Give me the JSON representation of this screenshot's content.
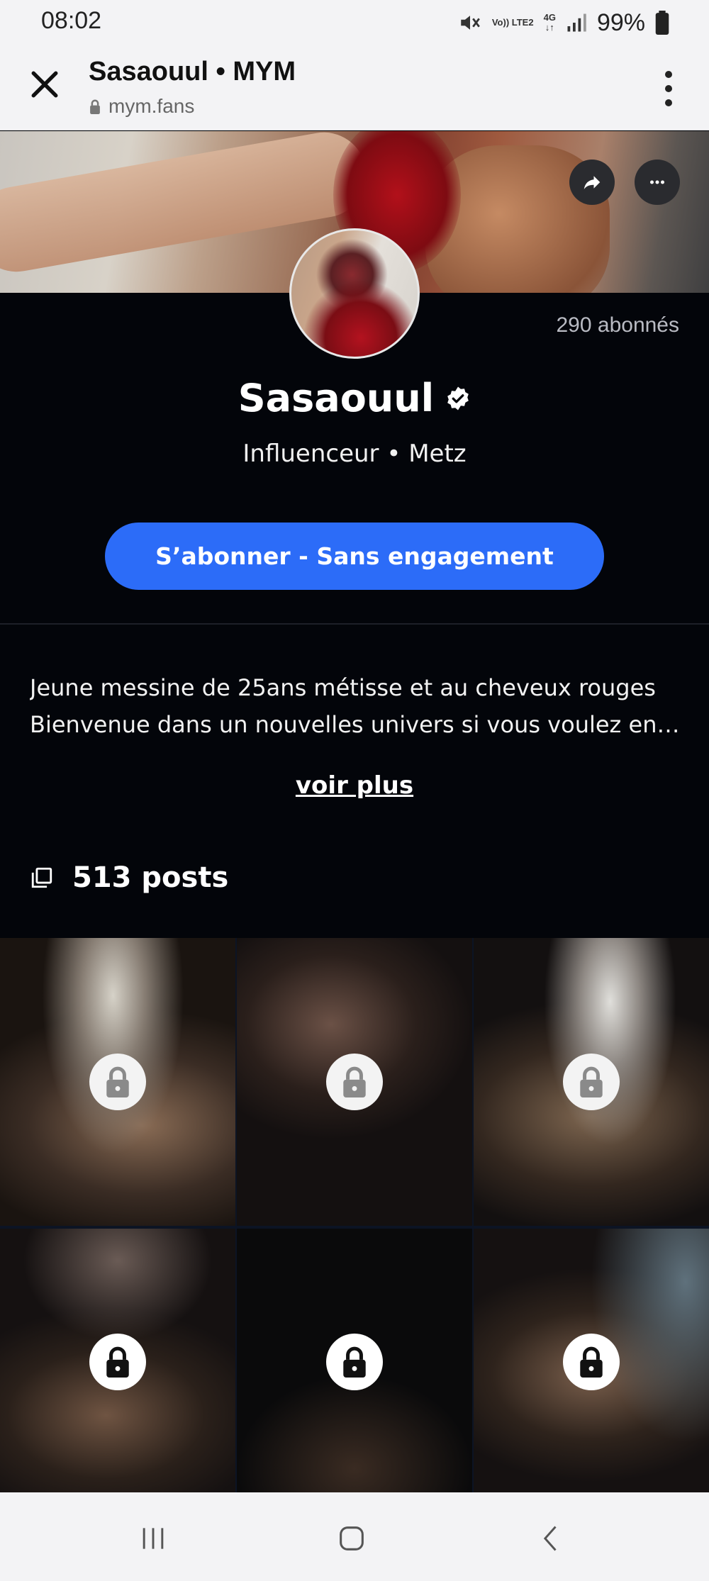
{
  "status_bar": {
    "time": "08:02",
    "network_volte": "Vo)) LTE2",
    "network_4g": "4G",
    "battery": "99%"
  },
  "browser": {
    "title": "Sasaouul • MYM",
    "url": "mym.fans"
  },
  "profile": {
    "subscribers": "290 abonnés",
    "name": "Sasaouul",
    "subtitle": "Influenceur • Metz",
    "subscribe_label": "S’abonner - Sans engagement",
    "bio_lines": [
      "Jeune messine de 25ans métisse et au cheveux rouges",
      "Bienvenue dans un nouvelles univers si vous voulez en savoir plus"
    ],
    "voir_plus": "voir plus",
    "posts_count": "513 posts"
  },
  "grid": {
    "tiles": 6,
    "locked": true
  },
  "colors": {
    "accent": "#2c6cf8",
    "background": "#03050a",
    "browser_bar": "#f3f3f5"
  },
  "icons": {
    "close": "close-icon",
    "lock": "lock-icon",
    "menu": "kebab-menu-icon",
    "share": "share-icon",
    "more": "more-icon",
    "verified": "verified-badge-icon",
    "posts": "posts-stack-icon"
  }
}
